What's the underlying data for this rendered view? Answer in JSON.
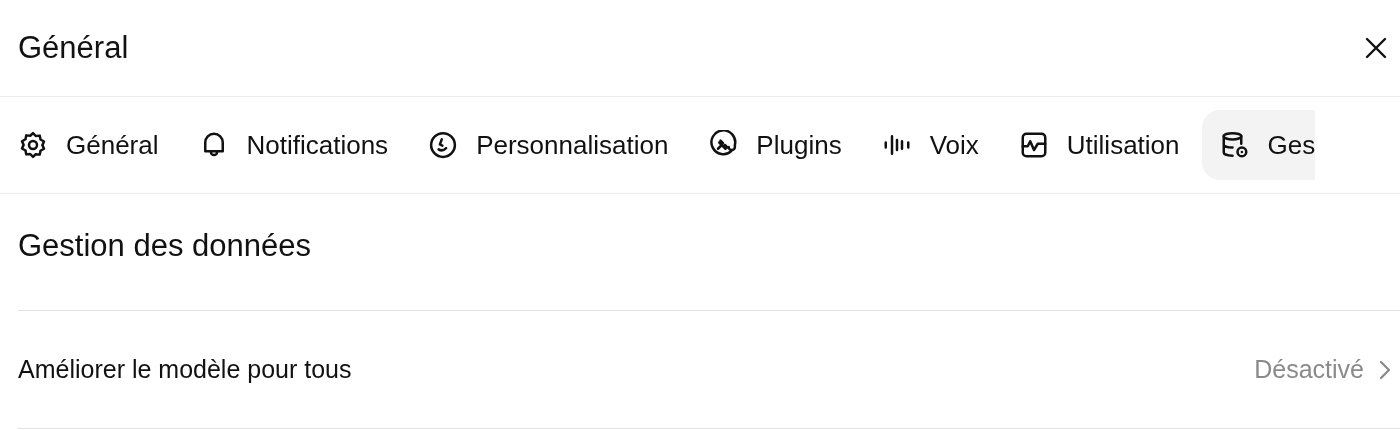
{
  "dialog": {
    "title": "Général"
  },
  "tabs": [
    {
      "label": "Général",
      "selected": false
    },
    {
      "label": "Notifications",
      "selected": false
    },
    {
      "label": "Personnalisation",
      "selected": false
    },
    {
      "label": "Plugins",
      "selected": false
    },
    {
      "label": "Voix",
      "selected": false
    },
    {
      "label": "Utilisation",
      "selected": false
    },
    {
      "label": "Ges",
      "selected": true
    }
  ],
  "section": {
    "title": "Gestion des données"
  },
  "settings": [
    {
      "label": "Améliorer le modèle pour tous",
      "value": "Désactivé"
    }
  ]
}
